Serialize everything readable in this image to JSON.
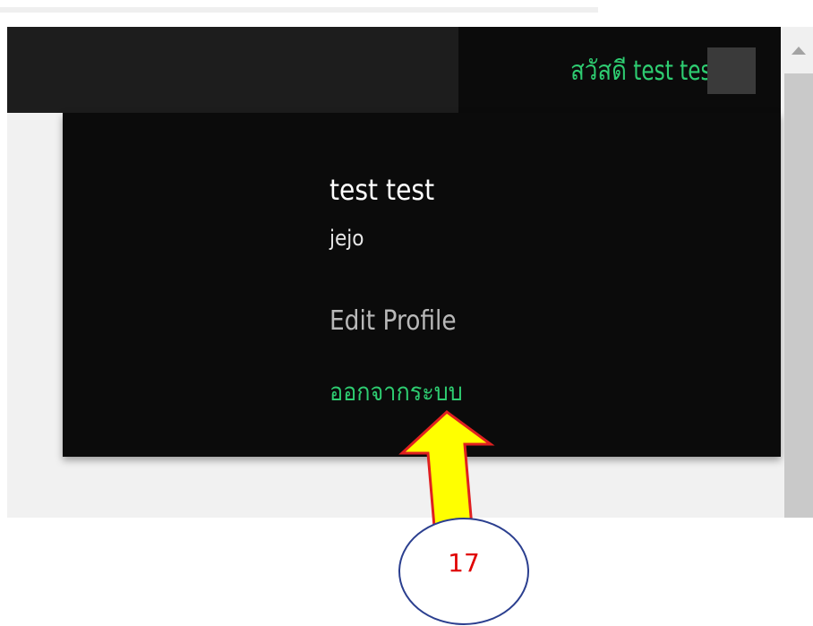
{
  "admin_bar": {
    "greeting": "สวัสดี test test"
  },
  "account_menu": {
    "display_name": "test test",
    "username": "jejo",
    "edit_profile": "Edit Profile",
    "logout": "ออกจากระบบ"
  },
  "annotation": {
    "step_number": "17",
    "arrow_color": "#ffff00",
    "arrow_outline": "#e02020",
    "circle_outline": "#2b3f8f"
  },
  "colors": {
    "accent_green": "#2ecc71",
    "menu_bg": "#0b0b0b",
    "admin_bar_bg": "#1d1d1d"
  },
  "icons": {
    "avatar": "user-avatar-placeholder",
    "scroll_up": "triangle-up-icon"
  }
}
